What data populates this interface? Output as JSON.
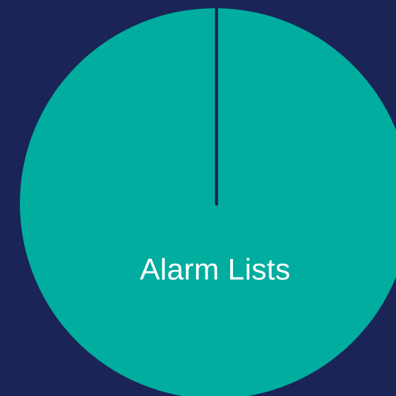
{
  "tile": {
    "label": "Alarm Lists"
  },
  "colors": {
    "background": "#1b2456",
    "slice_fill": "#00ad9e",
    "divider": "#1b2456",
    "label": "#ffffff"
  }
}
